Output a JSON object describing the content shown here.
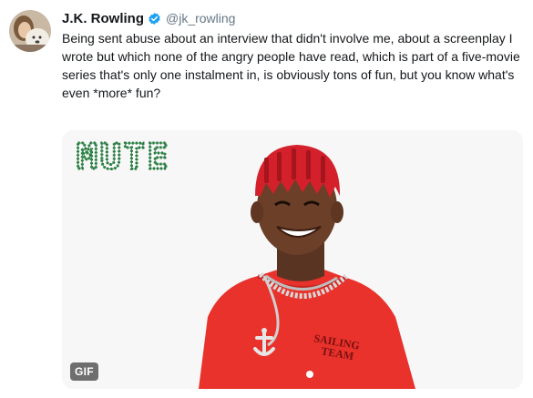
{
  "tweet": {
    "display_name": "J.K. Rowling",
    "handle": "@jk_rowling",
    "text_lines": [
      "Being sent abuse about an interview that didn't involve me, about a screenplay I",
      "wrote but which none of the angry people have read, which is part of a five-movie",
      "series that's only one instalment in, is obviously tons of fun, but you know what's",
      "even *more* fun?"
    ]
  },
  "media": {
    "overlay_text": "MUTE",
    "shirt_text_line1": "SAILING",
    "shirt_text_line2": "TEAM",
    "badge": "GIF"
  },
  "colors": {
    "verified_blue": "#1da1f2",
    "handle_gray": "#657786",
    "mute_green": "#1e6b35",
    "shirt_red": "#e8322b"
  }
}
